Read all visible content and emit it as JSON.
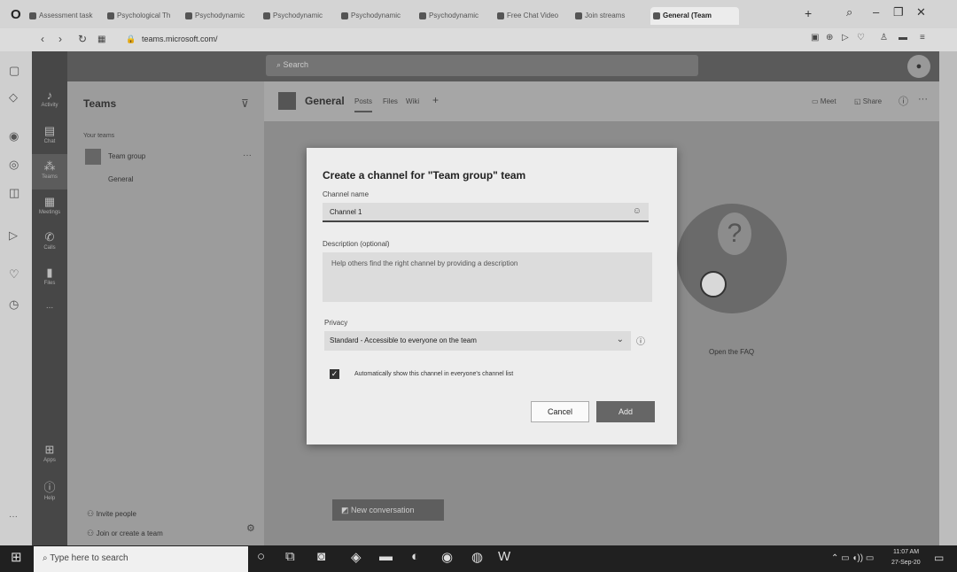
{
  "browser": {
    "tabs": [
      {
        "label": "Assessment task"
      },
      {
        "label": "Psychological Th"
      },
      {
        "label": "Psychodynamic"
      },
      {
        "label": "Psychodynamic"
      },
      {
        "label": "Psychodynamic"
      },
      {
        "label": "Psychodynamic"
      },
      {
        "label": "Free Chat Video"
      },
      {
        "label": "Join streams"
      },
      {
        "label": "General (Team"
      }
    ],
    "new_tab": "+",
    "url": "teams.microsoft.com/"
  },
  "teams": {
    "search_placeholder": "Search",
    "rail": [
      "Activity",
      "Chat",
      "Teams",
      "Meetings",
      "Calls",
      "Files",
      "..."
    ],
    "rail_bottom": [
      "Apps",
      "Help"
    ],
    "pane_title": "Teams",
    "your_teams_label": "Your teams",
    "team_name": "Team group",
    "channel_name": "General",
    "invite_people": "Invite people",
    "join_create": "Join or create a team",
    "channel_header": {
      "name": "General",
      "tabs": [
        "Posts",
        "Files",
        "Wiki"
      ],
      "meet": "Meet",
      "share": "Share"
    },
    "faq_link": "Open the FAQ",
    "new_conversation": "New conversation"
  },
  "dialog": {
    "title": "Create a channel for \"Team group\" team",
    "name_label": "Channel name",
    "name_value": "Channel 1",
    "desc_label": "Description (optional)",
    "desc_placeholder": "Help others find the right channel by providing a description",
    "privacy_label": "Privacy",
    "privacy_value": "Standard - Accessible to everyone on the team",
    "auto_show_label": "Automatically show this channel in everyone's channel list",
    "auto_show_checked": true,
    "cancel": "Cancel",
    "add": "Add"
  },
  "taskbar": {
    "search_placeholder": "Type here to search",
    "time": "11:07 AM",
    "date": "27-Sep-20"
  }
}
